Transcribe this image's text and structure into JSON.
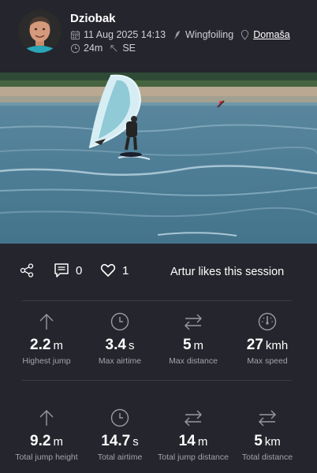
{
  "header": {
    "username": "Dziobak",
    "date": "11 Aug 2025 14:13",
    "sport": "Wingfoiling",
    "location": "Domaša",
    "duration": "24m",
    "wind_direction": "SE"
  },
  "actions": {
    "comments_count": "0",
    "likes_count": "1",
    "likes_text": "Artur likes this session"
  },
  "stats": {
    "row1": [
      {
        "icon": "arrow-up-icon",
        "value": "2.2",
        "unit": "m",
        "label": "Highest jump"
      },
      {
        "icon": "clock-icon",
        "value": "3.4",
        "unit": "s",
        "label": "Max airtime"
      },
      {
        "icon": "swap-arrows-icon",
        "value": "5",
        "unit": "m",
        "label": "Max distance"
      },
      {
        "icon": "speedometer-icon",
        "value": "27",
        "unit": "kmh",
        "label": "Max speed"
      }
    ],
    "row2": [
      {
        "icon": "arrow-up-icon",
        "value": "9.2",
        "unit": "m",
        "label": "Total jump height"
      },
      {
        "icon": "clock-icon",
        "value": "14.7",
        "unit": "s",
        "label": "Total airtime"
      },
      {
        "icon": "swap-arrows-icon",
        "value": "14",
        "unit": "m",
        "label": "Total jump distance"
      },
      {
        "icon": "swap-arrows-icon",
        "value": "5",
        "unit": "km",
        "label": "Total distance"
      }
    ]
  },
  "colors": {
    "background": "#25252d",
    "text": "#ffffff",
    "muted": "#a3a3ad",
    "icon": "#9a9aa4"
  }
}
